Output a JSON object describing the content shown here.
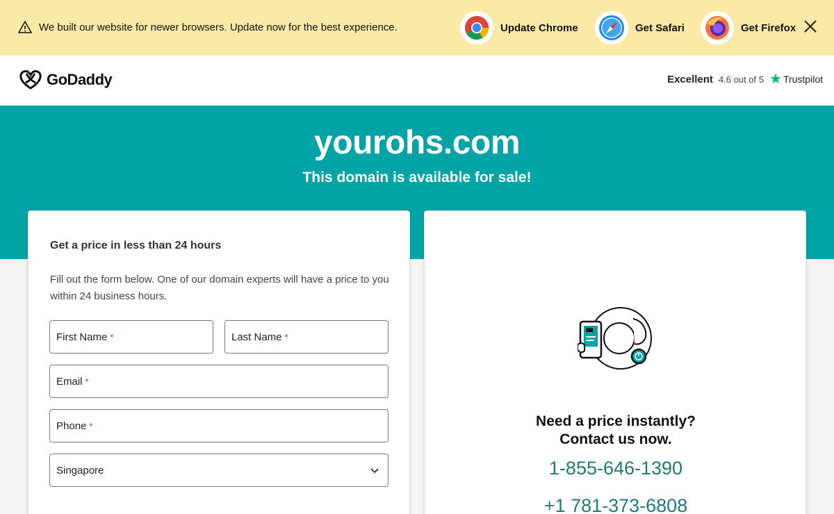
{
  "banner": {
    "message": "We built our website for newer browsers. Update now for the best experience.",
    "chrome_label": "Update Chrome",
    "safari_label": "Get Safari",
    "firefox_label": "Get Firefox"
  },
  "header": {
    "brand": "GoDaddy",
    "rating_word": "Excellent",
    "rating_score": "4.6 out of 5",
    "trustpilot": "Trustpilot"
  },
  "hero": {
    "domain": "yourohs.com",
    "subtitle": "This domain is available for sale!"
  },
  "form": {
    "title": "Get a price in less than 24 hours",
    "description": "Fill out the form below. One of our domain experts will have a price to you within 24 business hours.",
    "first_name_label": "First Name",
    "last_name_label": "Last Name",
    "email_label": "Email",
    "phone_label": "Phone",
    "required_mark": "*",
    "country_value": "Singapore"
  },
  "contact": {
    "question_line1": "Need a price instantly?",
    "question_line2": "Contact us now.",
    "phone1": "1-855-646-1390",
    "phone2": "+1 781-373-6808"
  },
  "colors": {
    "banner_bg": "#fbe9a6",
    "hero_bg": "#00a4a6",
    "phone_link": "#1f7a7a",
    "trustpilot_star": "#00b67a",
    "required": "#dd2222"
  }
}
